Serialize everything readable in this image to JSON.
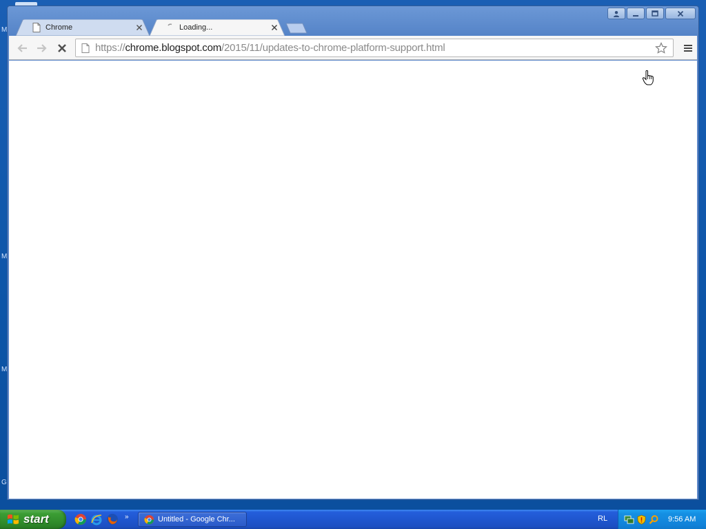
{
  "browser": {
    "tabs": [
      {
        "title": "Chrome",
        "active": false,
        "icon": "page-icon"
      },
      {
        "title": "Loading...",
        "active": true,
        "icon": "spinner-icon"
      }
    ],
    "omnibox": {
      "scheme": "https://",
      "host": "chrome.blogspot.com",
      "path": "/2015/11/updates-to-chrome-platform-support.html"
    }
  },
  "desktop": {
    "edge_letters": [
      "M",
      "M",
      "M",
      "G"
    ]
  },
  "taskbar": {
    "start_label": "start",
    "quick_launch": [
      "chrome-icon",
      "ie-icon",
      "firefox-icon"
    ],
    "quick_launch_more": "»",
    "active_task": "Untitled - Google Chr...",
    "language": "RL",
    "clock": "9:56 AM"
  },
  "colors": {
    "window_frame": "#5b87c9",
    "taskbar": "#245edb",
    "start_green": "#3c9d34",
    "tray": "#1590e3"
  }
}
